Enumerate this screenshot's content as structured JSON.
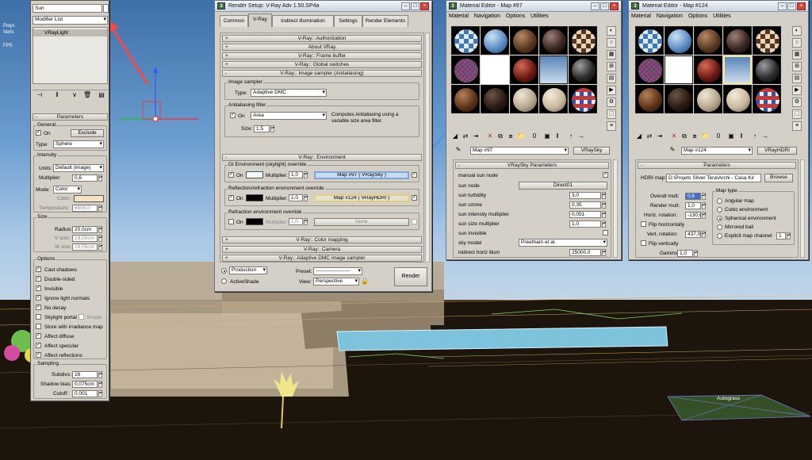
{
  "viewport": {
    "sky_color": "#5f95c9",
    "ground_color": "#1d140c",
    "stats_labels": [
      "Polys",
      "Verts",
      "FPS"
    ],
    "object_label": "Autograss"
  },
  "modify_panel": {
    "name_value": "Sun",
    "modifier_list": "Modifier List",
    "stack_item": "VRayLight",
    "rollout_title": "Parameters",
    "general": {
      "title": "General",
      "on_label": "On",
      "exclude_label": "Exclude",
      "type_label": "Type:",
      "type_value": "Sphere"
    },
    "intensity": {
      "title": "Intensity",
      "units_label": "Units:",
      "units_value": "Default (image)",
      "multiplier_label": "Multiplier:",
      "multiplier_value": "0,6",
      "mode_label": "Mode:",
      "mode_value": "Color",
      "color_label": "Color:",
      "color_swatch": "#f6e2c4",
      "temperature_label": "Temperature:",
      "temperature_value": "6500,0"
    },
    "size": {
      "title": "Size",
      "radius_label": "Radius:",
      "radius_value": "20,0cm",
      "vsize_label": "V size:",
      "vsize_value": "19,05cm",
      "wsize_label": "W size:",
      "wsize_value": "19,05cm"
    },
    "options": {
      "title": "Options",
      "items": [
        {
          "label": "Cast shadows",
          "checked": "✓"
        },
        {
          "label": "Double-sided",
          "checked": "✓"
        },
        {
          "label": "Invisible",
          "checked": "✓"
        },
        {
          "label": "Ignore light normals",
          "checked": "✓"
        },
        {
          "label": "No decay",
          "checked": "✓"
        },
        {
          "label": "Skylight portal",
          "checked": ""
        },
        {
          "label": "Store with irradiance map",
          "checked": ""
        },
        {
          "label": "Affect diffuse",
          "checked": "✓"
        },
        {
          "label": "Affect specular",
          "checked": "✓"
        },
        {
          "label": "Affect reflections",
          "checked": "✓"
        }
      ],
      "simple_label": "Simple"
    },
    "sampling": {
      "title": "Sampling",
      "subdivs_label": "Subdivs:",
      "subdivs_value": "16",
      "shadow_bias_label": "Shadow bias:",
      "shadow_bias_value": "0,075cm",
      "cutoff_label": "Cutoff:",
      "cutoff_value": "0,001"
    }
  },
  "render_setup": {
    "title": "Render Setup: V-Ray Adv 1.50.SP4a",
    "tabs": [
      "Common",
      "V-Ray",
      "Indirect illumination",
      "Settings",
      "Render Elements"
    ],
    "rollouts_top": [
      "V-Ray:: Authorization",
      "About VRay",
      "V-Ray:: Frame buffer",
      "V-Ray:: Global switches",
      "V-Ray:: Image sampler (Antialiasing)"
    ],
    "image_sampler": {
      "title": "Image sampler",
      "type_label": "Type:",
      "type_value": "Adaptive DMC"
    },
    "aa_filter": {
      "title": "Antialiasing filter",
      "on_label": "On",
      "filter_value": "Area",
      "size_label": "Size:",
      "size_value": "1,5",
      "description": "Computes Antialiasing using a variable size area filter."
    },
    "environment_rollout": "V-Ray:: Environment",
    "gi_env": {
      "title": "GI Environment (skylight) override",
      "on_label": "On",
      "multiplier_label": "Multiplier:",
      "multiplier_value": "1,0",
      "map_label": "Map #97  ( VRaySky )"
    },
    "refl_env": {
      "title": "Reflection/refraction environment override",
      "on_label": "On",
      "multiplier_label": "Multiplier:",
      "multiplier_value": "1,0",
      "map_label": "Map #124  ( VRayHDRI )"
    },
    "refr_env": {
      "title": "Refraction environment override",
      "on_label": "On",
      "multiplier_label": "Multiplier:",
      "multiplier_value": "1,0",
      "map_label": "None"
    },
    "rollouts_bottom": [
      "V-Ray:: Color mapping",
      "V-Ray:: Camera",
      "V-Ray:: Adaptive DMC image sampler"
    ],
    "production_label": "Production",
    "activeshade_label": "ActiveShade",
    "preset_label": "Preset:",
    "preset_value": "--------------------",
    "view_label": "View:",
    "view_value": "Perspective",
    "render_button": "Render"
  },
  "mat_editor_1": {
    "title": "Material Editor - Map #97",
    "menu": [
      "Material",
      "Navigation",
      "Options",
      "Utilities"
    ],
    "map_name": "Map #97",
    "map_type": "VRaySky",
    "rollout_title": "VRaySky Parameters",
    "params": {
      "manual_sun_node": "manual sun node",
      "sun_node_label": "sun node",
      "sun_node_value": "Direct01",
      "turbidity_label": "sun turbidity",
      "turbidity_value": "3,0",
      "ozone_label": "sun ozone",
      "ozone_value": "0,35",
      "intensity_label": "sun intensity multiplier",
      "intensity_value": "0,051",
      "size_label": "sun size multiplier",
      "size_value": "1,0",
      "invisible_label": "sun invisible",
      "sky_model_label": "sky model",
      "sky_model_value": "Preetham et al.",
      "horiz_label": "indirect horiz illum",
      "horiz_value": "25000,0"
    }
  },
  "mat_editor_2": {
    "title": "Material Editor - Map #124",
    "menu": [
      "Material",
      "Navigation",
      "Options",
      "Utilities"
    ],
    "map_name": "Map #124",
    "map_type": "VRayHDRI",
    "rollout_title": "Parameters",
    "hdri_label": "HDRI map:",
    "hdri_path": "D:\\Projets Silver Tera\\Archi - Casa Kir",
    "browse_label": "Browse",
    "overall_label": "Overall mult:",
    "overall_value": "0,6",
    "render_mult_label": "Render mult:",
    "render_mult_value": "1,0",
    "horiz_rot_label": "Horiz. rotation:",
    "horiz_rot_value": "-130,0",
    "flip_h_label": "Flip horizontally",
    "vert_rot_label": "Vert. rotation:",
    "vert_rot_value": "437,0",
    "flip_v_label": "Flip vertically",
    "gamma_label": "Gamma:",
    "gamma_value": "1,0",
    "map_type_title": "Map type",
    "map_types": [
      "Angular map",
      "Cubic environment",
      "Spherical environment",
      "Mirrored ball",
      "Explicit map channel"
    ],
    "channel_value": "1"
  }
}
